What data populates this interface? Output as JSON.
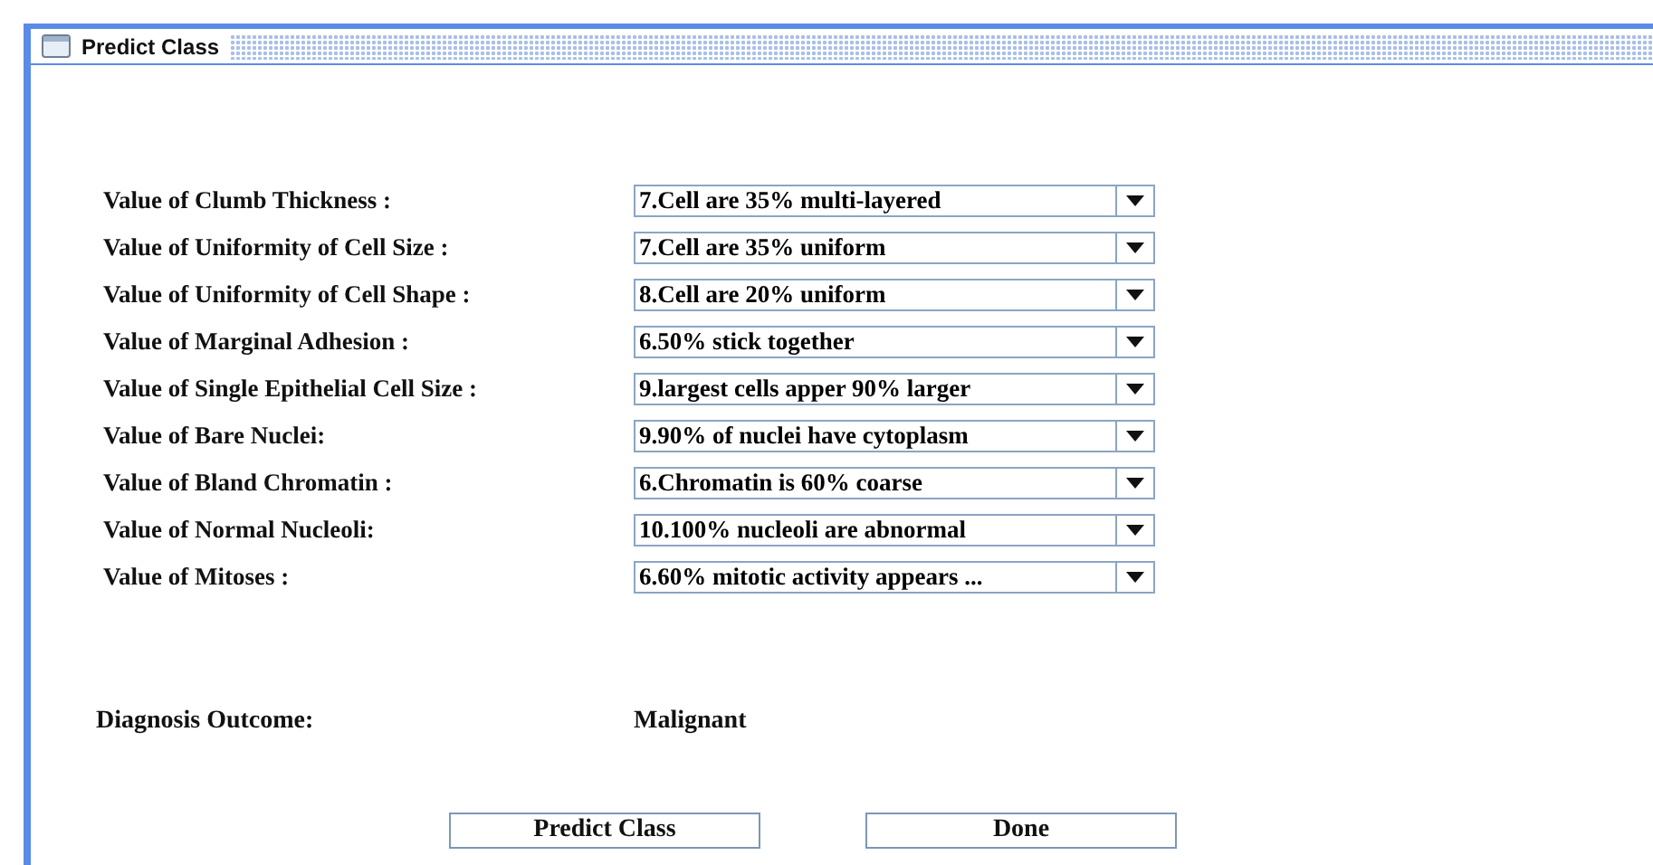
{
  "window": {
    "title": "Predict Class"
  },
  "fields": [
    {
      "label": "Value of Clumb Thickness :",
      "value": "7.Cell are 35% multi-layered"
    },
    {
      "label": "Value of Uniformity of Cell Size :",
      "value": "7.Cell are 35% uniform"
    },
    {
      "label": "Value of Uniformity of Cell Shape :",
      "value": "8.Cell are 20% uniform"
    },
    {
      "label": "Value of Marginal Adhesion :",
      "value": "6.50% stick together"
    },
    {
      "label": "Value of Single Epithelial Cell Size :",
      "value": "9.largest cells apper 90% larger"
    },
    {
      "label": "Value of Bare Nuclei:",
      "value": "9.90% of nuclei have cytoplasm"
    },
    {
      "label": "Value of Bland Chromatin :",
      "value": "6.Chromatin is 60% coarse"
    },
    {
      "label": "Value of Normal Nucleoli:",
      "value": "10.100% nucleoli are abnormal"
    },
    {
      "label": "Value of Mitoses :",
      "value": "6.60% mitotic activity appears ..."
    }
  ],
  "diagnosis": {
    "label": "Diagnosis Outcome:",
    "value": "Malignant"
  },
  "buttons": [
    "Predict Class",
    "Done"
  ]
}
